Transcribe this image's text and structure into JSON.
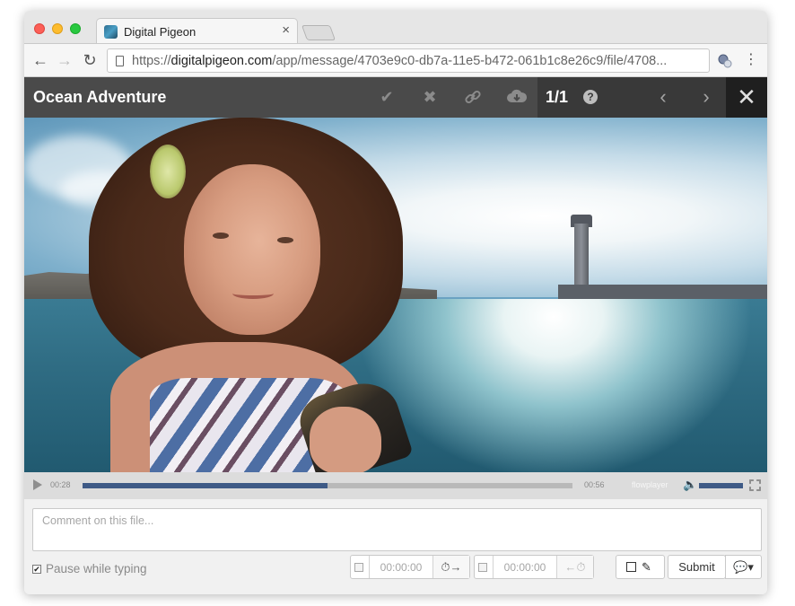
{
  "browser": {
    "tab": {
      "title": "Digital Pigeon",
      "close": "×"
    },
    "url": {
      "scheme": "https://",
      "host": "digitalpigeon.com",
      "path": "/app/message/4703e9c0-db7a-11e5-b472-061b1c8e26c9/file/4708..."
    },
    "nav": {
      "back": "←",
      "forward": "→",
      "reload": "↻",
      "menu": "⋮"
    }
  },
  "viewer": {
    "title": "Ocean Adventure",
    "counter": "1/1",
    "icons": {
      "approve": "✔",
      "reject": "✖",
      "link": "🔗",
      "download": "☁",
      "help": "?",
      "prev": "‹",
      "next": "›",
      "close": "✕"
    }
  },
  "player": {
    "elapsed": "00:28",
    "duration": "00:56",
    "progress": 0.5,
    "volume": 1.0,
    "brand": "flowplayer"
  },
  "comment": {
    "placeholder": "Comment on this file...",
    "pause_label": "Pause while typing",
    "pause_checked": true,
    "in_time": "00:00:00",
    "out_time": "00:00:00",
    "in_icon": "⏱→",
    "out_icon": "←⏱",
    "submit_label": "Submit",
    "chat_icon": "💬▾"
  },
  "colors": {
    "header": "#4a4a4a",
    "accent": "#3e5a86"
  }
}
